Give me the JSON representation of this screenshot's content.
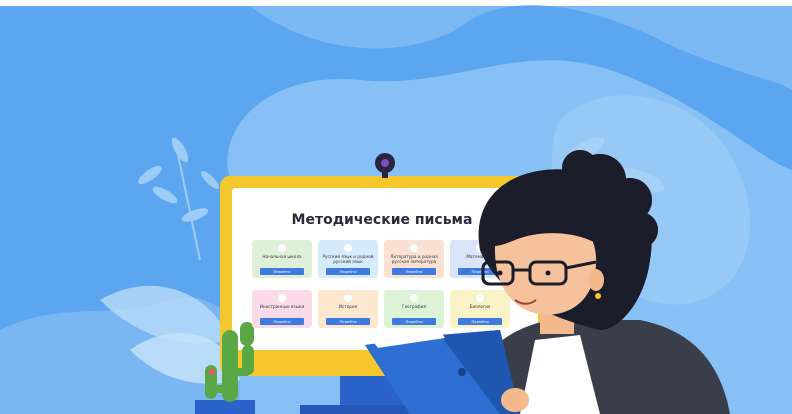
{
  "screen": {
    "title": "Методические письма",
    "cards": [
      {
        "label": "Начальная школа",
        "button": "Перейти",
        "color": "#dff0d8"
      },
      {
        "label": "Русский язык и родной русский язык",
        "button": "Перейти",
        "color": "#d6ecfa"
      },
      {
        "label": "Литература и родная русская литература",
        "button": "Перейти",
        "color": "#fbe1d2"
      },
      {
        "label": "Математика",
        "button": "Перейти",
        "color": "#dce4fb"
      },
      {
        "label": "Иностранные языки",
        "button": "Перейти",
        "color": "#fbdbe8"
      },
      {
        "label": "История",
        "button": "Перейти",
        "color": "#fde7cf"
      },
      {
        "label": "География",
        "button": "Перейти",
        "color": "#dcf3d6"
      },
      {
        "label": "Биология",
        "button": "Перейти",
        "color": "#fbf3c8"
      }
    ]
  },
  "colors": {
    "sky": "#5ba6ef",
    "sky_light": "#8ec4f6",
    "monitor_frame": "#f6c72c",
    "hair": "#1c1d2b",
    "book": "#2e6fd3",
    "jacket": "#3a3d4a",
    "cactus": "#5aa845",
    "pot": "#2a62c9"
  }
}
